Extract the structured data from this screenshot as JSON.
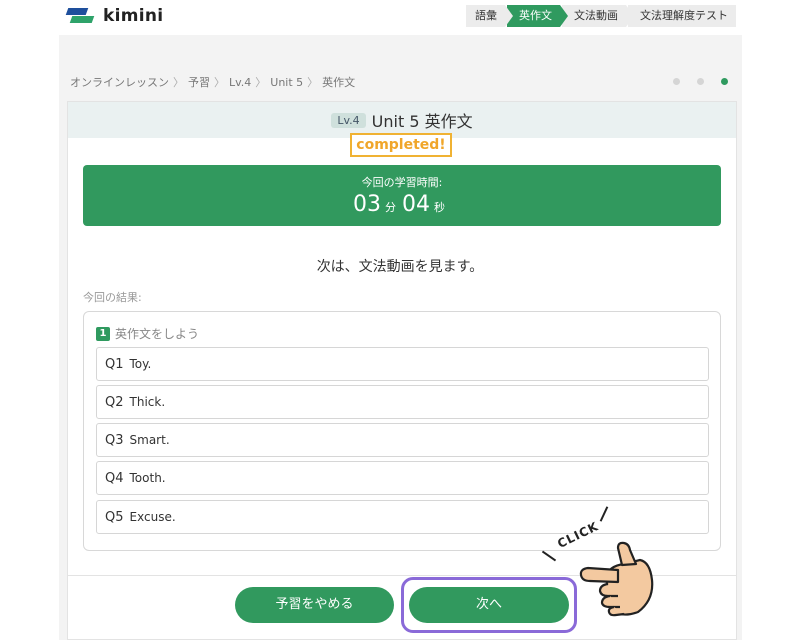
{
  "header": {
    "logo_text": "kimini",
    "steps": [
      {
        "label": "語彙",
        "active": false
      },
      {
        "label": "英作文",
        "active": true
      },
      {
        "label": "文法動画",
        "active": false
      },
      {
        "label": "文法理解度テスト",
        "active": false
      }
    ]
  },
  "breadcrumb": {
    "items": [
      "オンラインレッスン",
      "予習",
      "Lv.4",
      "Unit 5",
      "英作文"
    ],
    "separator": "〉"
  },
  "progress_dots": {
    "total": 3,
    "current": 3
  },
  "card": {
    "level_badge": "Lv.4",
    "title": "Unit 5 英作文",
    "completed_label": "completed!",
    "study_time": {
      "label": "今回の学習時間:",
      "minutes": "03",
      "minutes_unit": "分",
      "seconds": "04",
      "seconds_unit": "秒"
    },
    "next_message": "次は、文法動画を見ます。",
    "result_label": "今回の結果:",
    "section": {
      "number": "1",
      "title": "英作文をしよう",
      "questions": [
        {
          "num": "Q1",
          "text": "Toy."
        },
        {
          "num": "Q2",
          "text": "Thick."
        },
        {
          "num": "Q3",
          "text": "Smart."
        },
        {
          "num": "Q4",
          "text": "Tooth."
        },
        {
          "num": "Q5",
          "text": "Excuse."
        }
      ]
    }
  },
  "buttons": {
    "quit_label": "予習をやめる",
    "next_label": "次へ"
  },
  "overlay": {
    "click_label": "CLICK",
    "hand_icon": "pointing-hand-icon"
  },
  "colors": {
    "accent_green": "#31995e",
    "completed_orange": "#f0a62a",
    "highlight_purple": "#8a6ad8",
    "logo_blue": "#1e4f9c"
  }
}
